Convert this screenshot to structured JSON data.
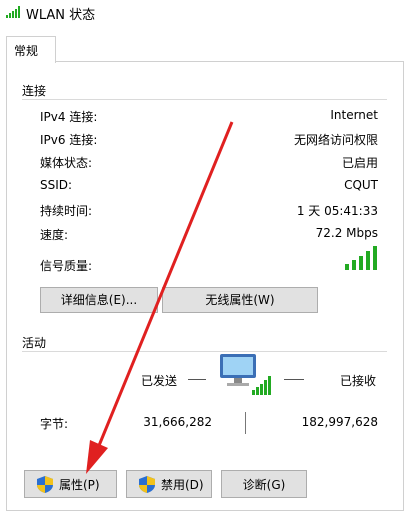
{
  "window": {
    "title": "WLAN 状态"
  },
  "tabs": [
    {
      "label": "常规"
    }
  ],
  "connection": {
    "title": "连接",
    "rows": [
      {
        "label": "IPv4 连接:",
        "value": "Internet"
      },
      {
        "label": "IPv6 连接:",
        "value": "无网络访问权限"
      },
      {
        "label": "媒体状态:",
        "value": "已启用"
      },
      {
        "label": "SSID:",
        "value": "CQUT"
      },
      {
        "label": "持续时间:",
        "value": "1 天 05:41:33"
      },
      {
        "label": "速度:",
        "value": "72.2 Mbps"
      }
    ],
    "signal_label": "信号质量:",
    "signal_bars": 5,
    "details_button": "详细信息(E)...",
    "wireless_props_button": "无线属性(W)"
  },
  "activity": {
    "title": "活动",
    "sent_label": "已发送",
    "received_label": "已接收",
    "bytes_label": "字节:",
    "bytes_sent": "31,666,282",
    "bytes_received": "182,997,628"
  },
  "bottom_buttons": {
    "properties": "属性(P)",
    "disable": "禁用(D)",
    "diagnose": "诊断(G)"
  },
  "colors": {
    "signal": "#22aa22",
    "arrow": "#e02020",
    "shield_blue": "#2a6fd1",
    "shield_yellow": "#f2c21b"
  }
}
